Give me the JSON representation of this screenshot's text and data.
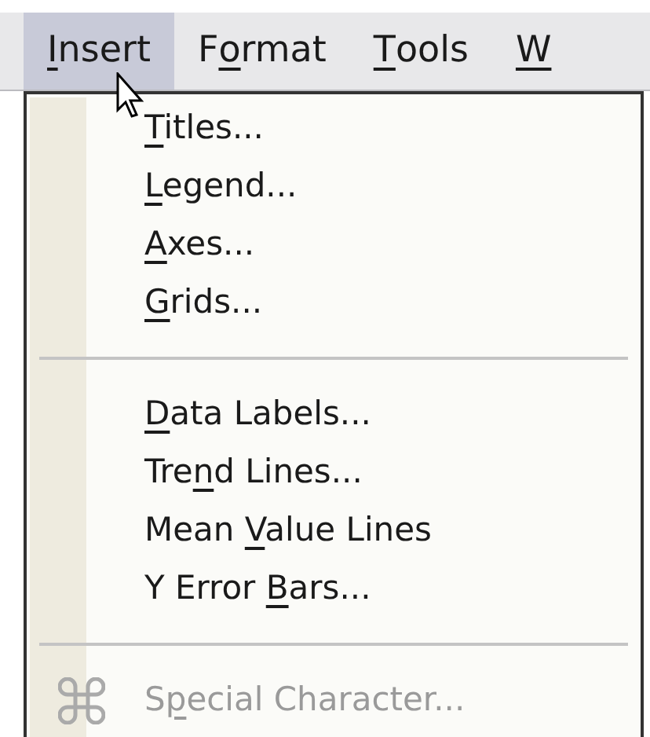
{
  "menubar": [
    {
      "key": "I",
      "after": "nsert",
      "selected": true
    },
    {
      "before": "F",
      "key": "o",
      "after": "rmat",
      "selected": false
    },
    {
      "key": "T",
      "after": "ools",
      "selected": false
    },
    {
      "key": "W",
      "selected": false
    }
  ],
  "menu": {
    "sections": [
      {
        "items": [
          {
            "kind": "plain",
            "key": "T",
            "after": "itles...",
            "disabled": false
          },
          {
            "kind": "plain",
            "key": "L",
            "after": "egend...",
            "disabled": false
          },
          {
            "kind": "plain",
            "key": "A",
            "after": "xes...",
            "disabled": false
          },
          {
            "kind": "plain",
            "key": "G",
            "after": "rids...",
            "disabled": false
          }
        ]
      },
      {
        "items": [
          {
            "kind": "plain",
            "key": "D",
            "after": "ata Labels...",
            "disabled": false
          },
          {
            "kind": "plain",
            "before": "Tre",
            "key": "n",
            "after": "d Lines...",
            "disabled": false
          },
          {
            "kind": "plain",
            "before": "Mean ",
            "key": "V",
            "after": "alue Lines",
            "disabled": false
          },
          {
            "kind": "plain",
            "before": "Y Error ",
            "key": "B",
            "after": "ars...",
            "disabled": false
          }
        ]
      },
      {
        "items": [
          {
            "kind": "with-icon",
            "before": "S",
            "key": "p",
            "after": "ecial Character...",
            "disabled": true
          }
        ]
      }
    ]
  }
}
